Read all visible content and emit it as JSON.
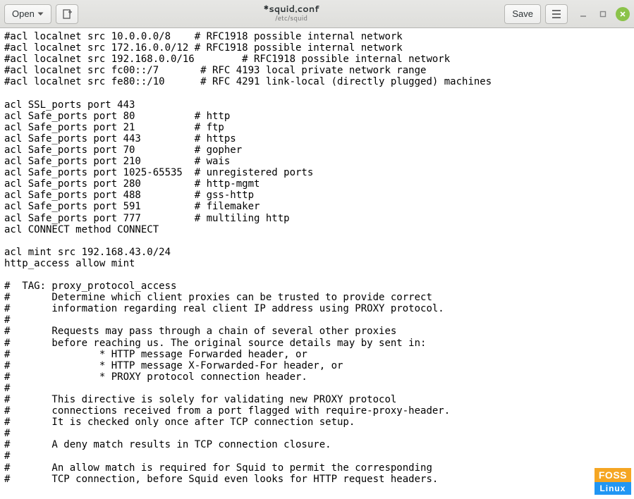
{
  "header": {
    "open_label": "Open",
    "save_label": "Save",
    "title": "*squid.conf",
    "subtitle": "/etc/squid"
  },
  "editor": {
    "lines": [
      "#acl localnet src 10.0.0.0/8    # RFC1918 possible internal network",
      "#acl localnet src 172.16.0.0/12 # RFC1918 possible internal network",
      "#acl localnet src 192.168.0.0/16        # RFC1918 possible internal network",
      "#acl localnet src fc00::/7       # RFC 4193 local private network range",
      "#acl localnet src fe80::/10      # RFC 4291 link-local (directly plugged) machines",
      "",
      "acl SSL_ports port 443",
      "acl Safe_ports port 80          # http",
      "acl Safe_ports port 21          # ftp",
      "acl Safe_ports port 443         # https",
      "acl Safe_ports port 70          # gopher",
      "acl Safe_ports port 210         # wais",
      "acl Safe_ports port 1025-65535  # unregistered ports",
      "acl Safe_ports port 280         # http-mgmt",
      "acl Safe_ports port 488         # gss-http",
      "acl Safe_ports port 591         # filemaker",
      "acl Safe_ports port 777         # multiling http",
      "acl CONNECT method CONNECT",
      "",
      "acl mint src 192.168.43.0/24",
      "http_access allow mint",
      "",
      "#  TAG: proxy_protocol_access",
      "#       Determine which client proxies can be trusted to provide correct",
      "#       information regarding real client IP address using PROXY protocol.",
      "#",
      "#       Requests may pass through a chain of several other proxies",
      "#       before reaching us. The original source details may by sent in:",
      "#               * HTTP message Forwarded header, or",
      "#               * HTTP message X-Forwarded-For header, or",
      "#               * PROXY protocol connection header.",
      "#",
      "#       This directive is solely for validating new PROXY protocol",
      "#       connections received from a port flagged with require-proxy-header.",
      "#       It is checked only once after TCP connection setup.",
      "#",
      "#       A deny match results in TCP connection closure.",
      "#",
      "#       An allow match is required for Squid to permit the corresponding",
      "#       TCP connection, before Squid even looks for HTTP request headers."
    ]
  },
  "watermark": {
    "top": "FOSS",
    "bottom": "Linux"
  }
}
